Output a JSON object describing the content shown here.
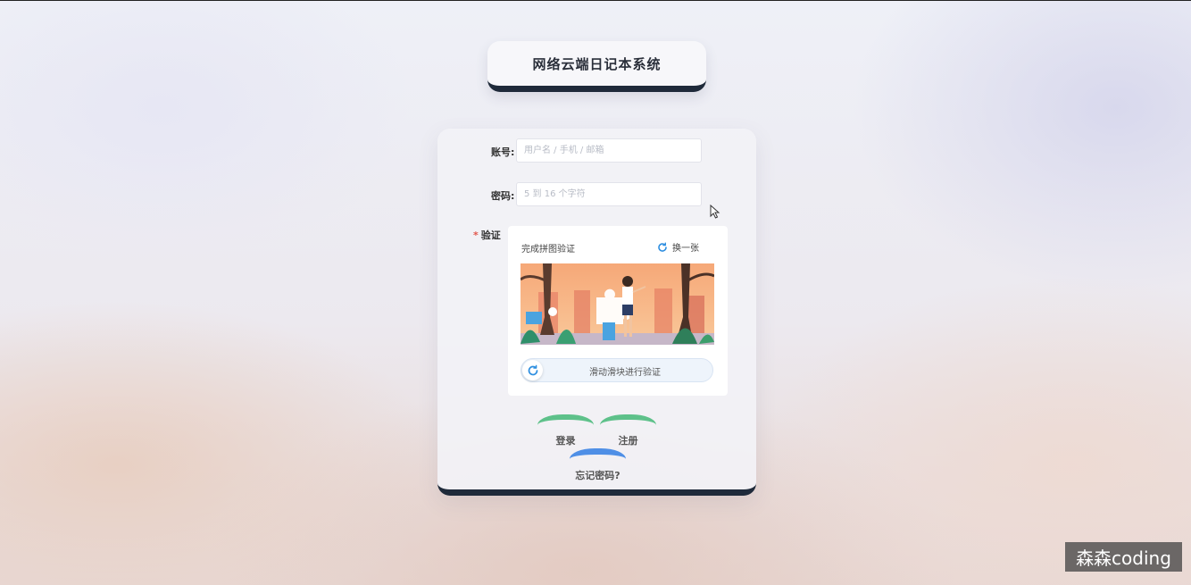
{
  "app": {
    "title": "网络云端日记本系统"
  },
  "form": {
    "account_label": "账号:",
    "account_placeholder": "用户名 / 手机 / 邮箱",
    "account_value": "",
    "password_label": "密码:",
    "password_placeholder": "5 到 16 个字符",
    "password_value": "",
    "verify_required_mark": "*",
    "verify_label": "验证"
  },
  "captcha": {
    "title": "完成拼图验证",
    "refresh_label": "换一张",
    "refresh_icon": "refresh-icon",
    "slider_text": "滑动滑块进行验证",
    "slider_icon": "refresh-icon",
    "slider_progress": 0
  },
  "actions": {
    "login_label": "登录",
    "register_label": "注册",
    "forgot_label": "忘记密码?"
  },
  "watermark": {
    "text": "森森coding"
  },
  "colors": {
    "accent_dark": "#1f2a3a",
    "button_green": "#5ec18a",
    "button_blue": "#4f8fe6",
    "required_red": "#e2574c",
    "refresh_blue": "#2f8fe0"
  }
}
